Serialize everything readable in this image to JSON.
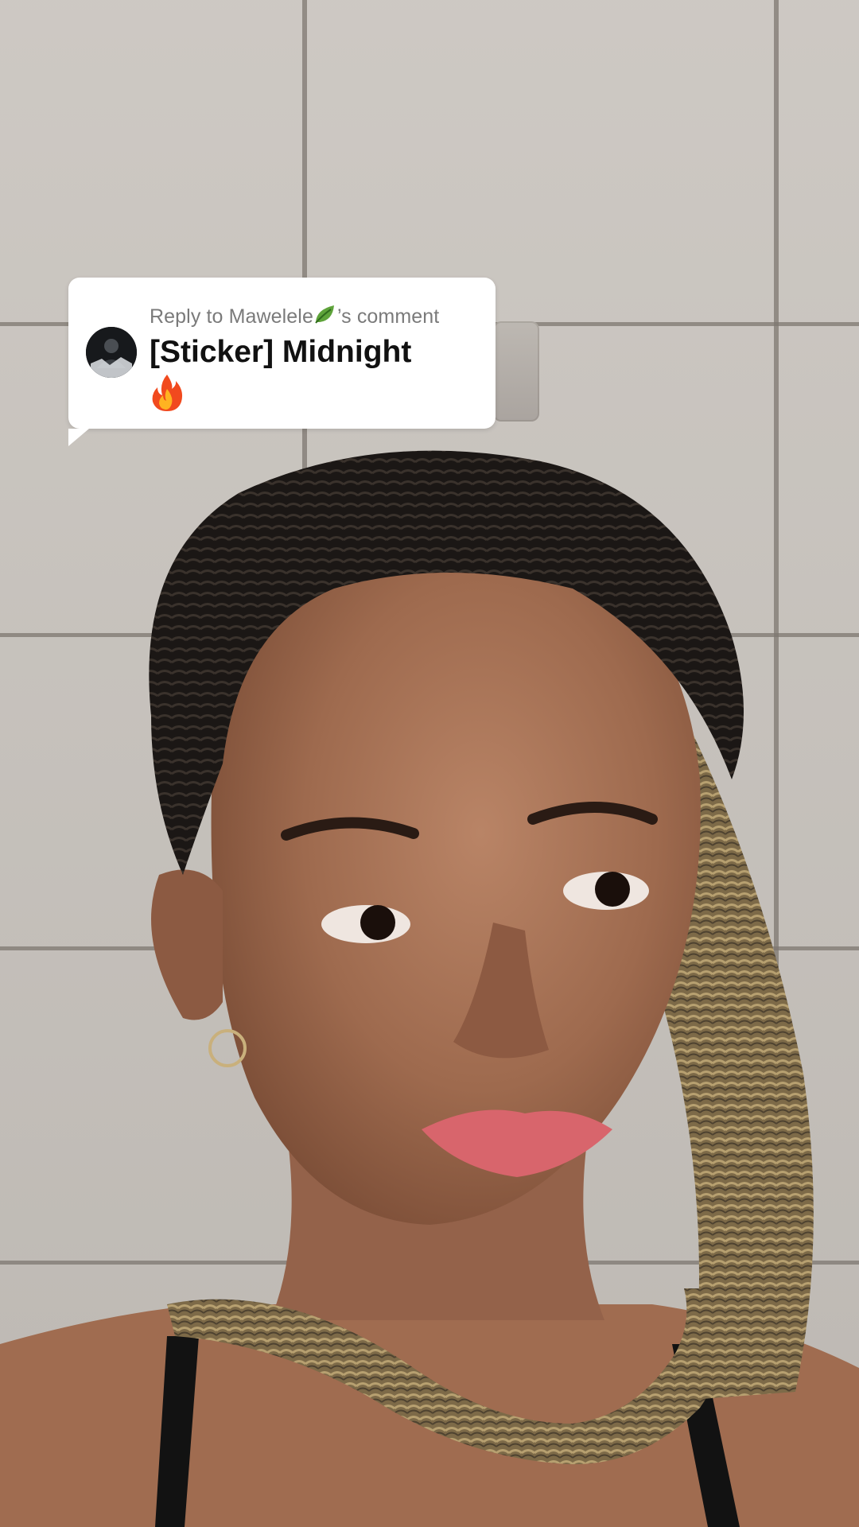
{
  "reply": {
    "prefix": "Reply to ",
    "username": "Mawelele",
    "suffix": "’s comment",
    "text": "[Sticker] Midnight",
    "icons": {
      "avatar": "user-avatar",
      "leaf": "leaf-emoji-icon",
      "fire": "fire-emoji-icon"
    }
  },
  "colors": {
    "bubble_background": "#ffffff",
    "header_text": "#7a7a7a",
    "comment_text": "#111111",
    "wall": "#c9c4be"
  }
}
